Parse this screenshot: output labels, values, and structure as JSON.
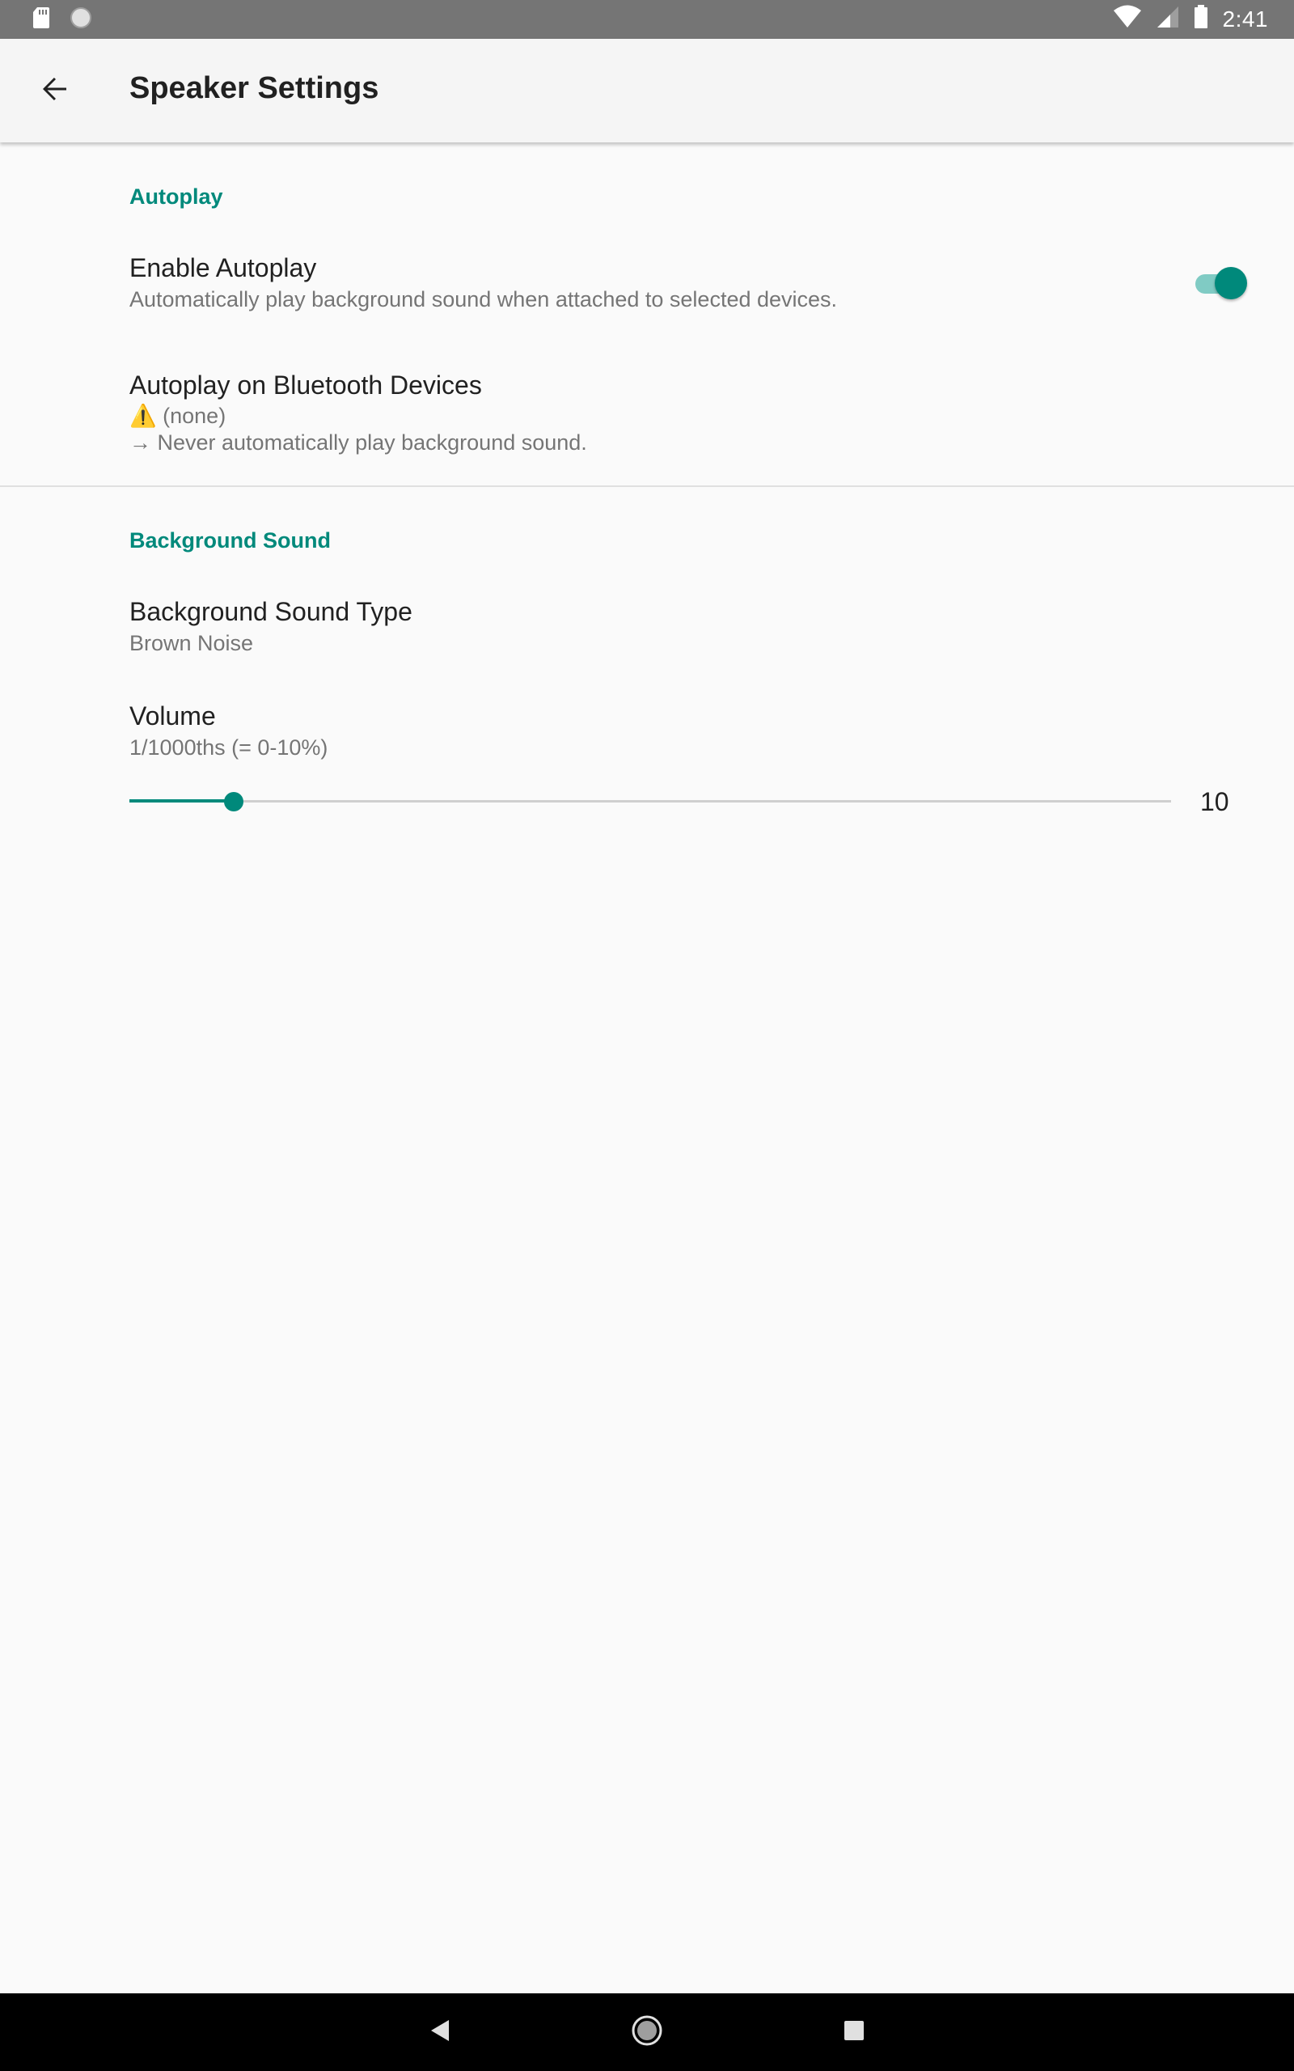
{
  "status_bar": {
    "time": "2:41",
    "icons": [
      "sd-card-icon",
      "circle-icon",
      "wifi-icon",
      "cell-signal-icon",
      "battery-icon"
    ]
  },
  "toolbar": {
    "back_icon": "arrow-back-icon",
    "title": "Speaker Settings"
  },
  "autoplay": {
    "header": "Autoplay",
    "enable": {
      "title": "Enable Autoplay",
      "summary": "Automatically play background sound when attached to selected devices.",
      "checked": true
    },
    "bluetooth": {
      "title": "Autoplay on Bluetooth Devices",
      "warning_icon": "⚠️",
      "line1": "(none)",
      "line2": "→ Never automatically play background sound."
    }
  },
  "background_sound": {
    "header": "Background Sound",
    "type": {
      "title": "Background Sound Type",
      "summary": "Brown Noise"
    },
    "volume": {
      "title": "Volume",
      "summary": "1/1000ths (= 0-10%)",
      "value_label": "10",
      "value": 10,
      "max": 100
    }
  },
  "colors": {
    "accent": "#00897b",
    "accent_light": "#80cbc4",
    "status_bar": "#757575",
    "background": "#fafafa"
  },
  "nav_bar": {
    "icons": [
      "nav-back-icon",
      "nav-home-icon",
      "nav-recents-icon"
    ]
  }
}
